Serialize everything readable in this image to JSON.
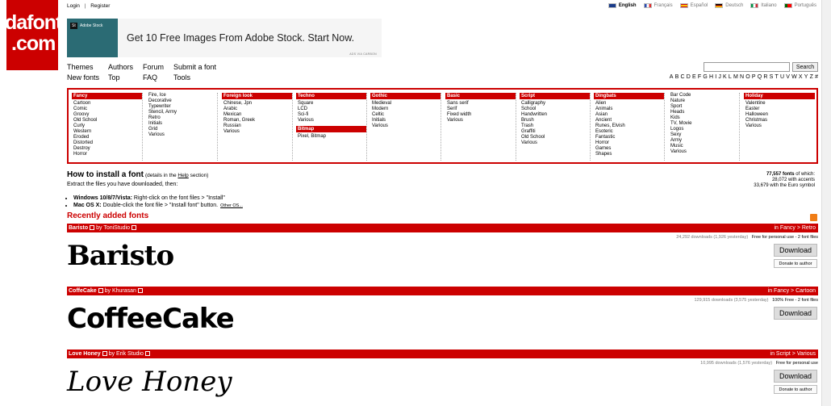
{
  "logo": {
    "line1": "dafont",
    "line2": ".com"
  },
  "top_links": {
    "login": "Login",
    "separator": "|",
    "register": "Register"
  },
  "languages": [
    {
      "label": "English",
      "active": true
    },
    {
      "label": "Français",
      "active": false
    },
    {
      "label": "Español",
      "active": false
    },
    {
      "label": "Deutsch",
      "active": false
    },
    {
      "label": "Italiano",
      "active": false
    },
    {
      "label": "Português",
      "active": false
    }
  ],
  "ad": {
    "thumb_tag": "St",
    "thumb_brand": "Adobe Stock",
    "headline": "Get 10 Free Images From Adobe Stock. Start Now.",
    "via": "ADS VIA CARBON"
  },
  "nav": {
    "themes": "Themes",
    "new_fonts": "New fonts",
    "authors": "Authors",
    "top": "Top",
    "forum": "Forum",
    "faq": "FAQ",
    "submit": "Submit a font",
    "tools": "Tools"
  },
  "search": {
    "button": "Search",
    "placeholder": ""
  },
  "alphabet": [
    "A",
    "B",
    "C",
    "D",
    "E",
    "F",
    "G",
    "H",
    "I",
    "J",
    "K",
    "L",
    "M",
    "N",
    "O",
    "P",
    "Q",
    "R",
    "S",
    "T",
    "U",
    "V",
    "W",
    "X",
    "Y",
    "Z",
    "#"
  ],
  "categories": [
    {
      "head": "Fancy",
      "items": [
        "Cartoon",
        "Comic",
        "Groovy",
        "Old School",
        "Curly",
        "Western",
        "Eroded",
        "Distorted",
        "Destroy",
        "Horror"
      ]
    },
    {
      "head": "",
      "items": [
        "Fire, Ice",
        "Decorative",
        "Typewriter",
        "Stencil, Army",
        "Retro",
        "Initials",
        "Grid",
        "Various"
      ]
    },
    {
      "head": "Foreign look",
      "items": [
        "Chinese, Jpn",
        "Arabic",
        "Mexican",
        "Roman, Greek",
        "Russian",
        "Various"
      ]
    },
    {
      "head": "Techno",
      "items": [
        "Square",
        "LCD",
        "Sci-fi",
        "Various"
      ],
      "head2": "Bitmap",
      "items2": [
        "Pixel, Bitmap"
      ]
    },
    {
      "head": "Gothic",
      "items": [
        "Medieval",
        "Modern",
        "Celtic",
        "Initials",
        "Various"
      ]
    },
    {
      "head": "Basic",
      "items": [
        "Sans serif",
        "Serif",
        "Fixed width",
        "Various"
      ]
    },
    {
      "head": "Script",
      "items": [
        "Calligraphy",
        "School",
        "Handwritten",
        "Brush",
        "Trash",
        "Graffiti",
        "Old School",
        "Various"
      ]
    },
    {
      "head": "Dingbats",
      "items": [
        "Alien",
        "Animals",
        "Asian",
        "Ancient",
        "Runes, Elvish",
        "Esoteric",
        "Fantastic",
        "Horror",
        "Games",
        "Shapes"
      ]
    },
    {
      "head": "",
      "items": [
        "Bar Code",
        "Nature",
        "Sport",
        "Heads",
        "Kids",
        "TV, Movie",
        "Logos",
        "Sexy",
        "Army",
        "Music",
        "Various"
      ]
    },
    {
      "head": "Holiday",
      "items": [
        "Valentine",
        "Easter",
        "Halloween",
        "Christmas",
        "Various"
      ]
    }
  ],
  "howto": {
    "title": "How to install a font",
    "details_pre": "(details in the ",
    "details_link": "Help",
    "details_post": " section)",
    "extract": "Extract the files you have downloaded, then:",
    "win_label": "Windows 10/8/7/Vista:",
    "win_text": " Right-click on the font files > \"Install\"",
    "mac_label": "Mac OS X:",
    "mac_text": " Double-click the font file > \"Install font\" button.",
    "other": "Other OS..."
  },
  "stats": {
    "count": "77,557 fonts",
    "count_suffix": " of which:",
    "accents": "28,072 with accents",
    "euro": "33,679 with the Euro symbol"
  },
  "recent_title": "Recently added fonts",
  "fonts": [
    {
      "name": "Baristo",
      "by": "by ToniStudio",
      "category": "in Fancy > Retro",
      "downloads": "24,292 downloads (1,926 yesterday)",
      "license": "Free for personal use - 2 font files",
      "download_label": "Download",
      "donate_label": "Donate to author",
      "preview": "Baristo"
    },
    {
      "name": "CoffeCake",
      "by": "by Khurasan",
      "category": "in Fancy > Cartoon",
      "downloads": "129,915 downloads (3,575 yesterday)",
      "license": "100% Free - 2 font files",
      "download_label": "Download",
      "donate_label": "",
      "preview": "CoffeeCake"
    },
    {
      "name": "Love Honey",
      "by": "by Erik Studio",
      "category": "in Script > Various",
      "downloads": "10,995 downloads (1,576 yesterday)",
      "license": "Free for personal use",
      "download_label": "Download",
      "donate_label": "Donate to author",
      "preview": "Love Honey"
    }
  ],
  "colors": {
    "brand_red": "#cc0000",
    "rss_orange": "#f07d16"
  }
}
